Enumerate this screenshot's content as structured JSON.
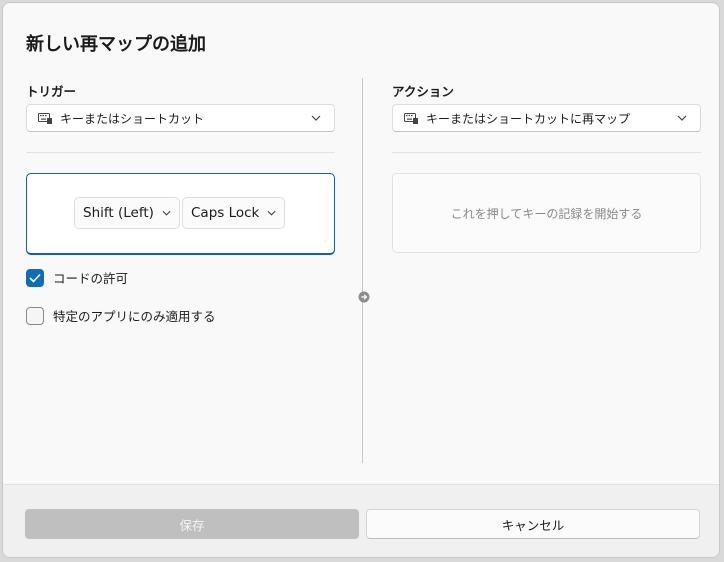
{
  "dialog": {
    "title": "新しい再マップの追加"
  },
  "trigger": {
    "label": "トリガー",
    "type_dropdown": {
      "selected": "キーまたはショートカット",
      "icon": "keyboard-icon"
    },
    "keys": [
      {
        "label": "Shift (Left)"
      },
      {
        "label": "Caps Lock"
      }
    ],
    "options": [
      {
        "label": "コードの許可",
        "checked": true
      },
      {
        "label": "特定のアプリにのみ適用する",
        "checked": false
      }
    ]
  },
  "action": {
    "label": "アクション",
    "type_dropdown": {
      "selected": "キーまたはショートカットに再マップ",
      "icon": "keyboard-icon"
    },
    "record_placeholder": "これを押してキーの記録を開始する"
  },
  "footer": {
    "save_label": "保存",
    "save_enabled": false,
    "cancel_label": "キャンセル"
  },
  "colors": {
    "accent": "#0f6cbd",
    "disabled_button": "#bfbfbf"
  }
}
